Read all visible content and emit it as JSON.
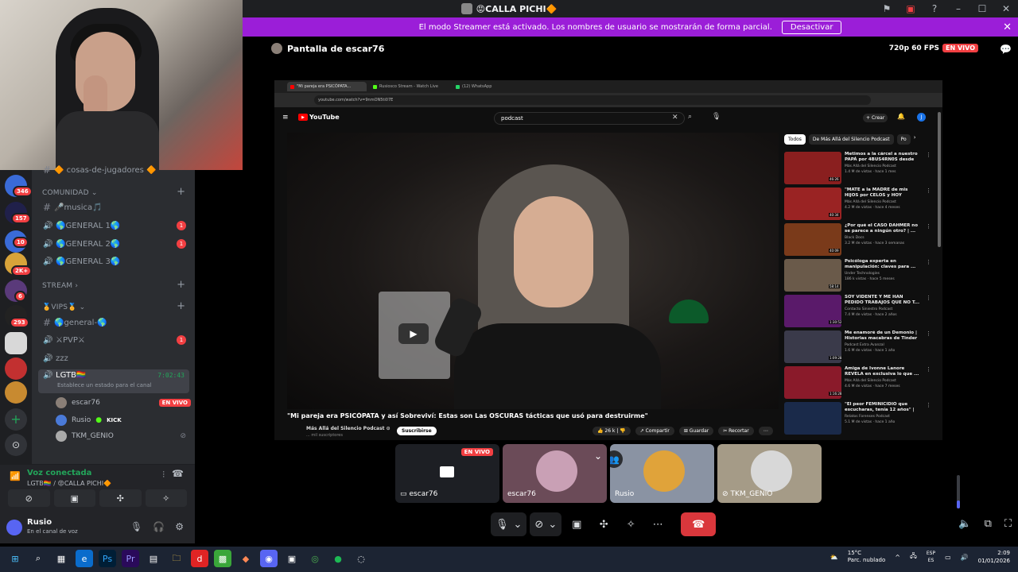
{
  "window": {
    "title": "😡CALLA PICHI🔶"
  },
  "banner": {
    "text": "El modo Streamer está activado. Los nombres de usuario se mostrarán de forma parcial.",
    "button": "Desactivar"
  },
  "rail": {
    "badges": [
      "346",
      "157",
      "10",
      "2K+",
      "6",
      "293"
    ]
  },
  "sidebar": {
    "partial_top": "🔶 cosas-de-jugadores 🔶",
    "categories": {
      "comunidad": "COMUNIDAD",
      "stream": "STREAM",
      "vips": "🏅VIPS🏅"
    },
    "channels": {
      "musica": "🎤musica🎵",
      "general1": "🌎GENERAL 1🌎",
      "general2": "🌎GENERAL 2🌎",
      "general3": "🌎GENERAL 3🌎",
      "general_text": "🌎general-🌎",
      "pvp": "⚔PVP⚔",
      "zzz": "zzz",
      "lgtb": "LGTB🏳‍🌈",
      "lgtb_time": "7:02:43",
      "lgtb_status": "Establece un estado para el canal"
    },
    "mentions": {
      "general1": "1",
      "general2": "1",
      "pvp": "1"
    },
    "voice_users": [
      {
        "name": "escar76",
        "tag": "EN VIVO"
      },
      {
        "name": "Rusio",
        "tag": "KICK"
      },
      {
        "name": "TKM_GENIO",
        "tag": ""
      }
    ]
  },
  "voice_panel": {
    "status": "Voz conectada",
    "channel": "LGTB🏳‍🌈 / 😡CALLA PICHI🔶"
  },
  "user": {
    "name": "Rusio",
    "status": "En el canal de voz"
  },
  "stream": {
    "host": "Pantalla de escar76",
    "quality": "720p 60 FPS",
    "live": "EN VIVO"
  },
  "browser": {
    "tabs": [
      "\"Mi pareja era PSICÓPATA...",
      "Rusiosco Stream - Watch Live",
      "(12) WhatsApp"
    ],
    "url": "youtube.com/watch?v=9nmON5ti07E",
    "yt_logo": "YouTube",
    "search": "podcast",
    "create": "Crear",
    "avatar": "J"
  },
  "video": {
    "title": "\"Mi pareja era PSICÓPATA y así Sobreviví: Estas son Las OSCURAS tácticas que usó para destruirme\"",
    "channel": "Más Allá del Silencio Podcast ⊙",
    "subs": "... mil suscriptores",
    "subscribe": "Suscribirse",
    "likes": "26 k",
    "share": "Compartir",
    "save": "Guardar",
    "clip": "Recortar"
  },
  "chips": [
    "Todos",
    "De Más Allá del Silencio Podcast",
    "Po"
  ],
  "recommendations": [
    {
      "title": "Metimos a la cárcel a nuestro PAPÁ por 4BUS4RN0S desde ...",
      "channel": "Más Allá del Silencio Podcast",
      "views": "1.4 M de vistas · hace 1 mes",
      "duration": "46:26",
      "color": "#8a1f1f"
    },
    {
      "title": "\"MATÉ a la MADRE de mis HIJOS por CELOS y HOY cump...",
      "channel": "Más Allá del Silencio Podcast",
      "views": "4.2 M de vistas · hace 4 meses",
      "duration": "40:34",
      "color": "#9a2323"
    },
    {
      "title": "¿Por qué el CASO DAHMER no se parece a ningún otro? | ...",
      "channel": "Black Docs",
      "views": "3.2 M de vistas · hace 3 semanas",
      "duration": "40:09",
      "color": "#7a3a1a"
    },
    {
      "title": "Psicóloga experta en manipulación: claves para ...",
      "channel": "Under Technologies",
      "views": "186 k vistas · hace 5 meses",
      "duration": "58:14",
      "color": "#6a5a4a"
    },
    {
      "title": "SOY VIDENTE Y ME HAN PEDIDO TRABAJOS QUE NO T...",
      "channel": "Contacto Siniestro Podcast",
      "views": "7.4 M de vistas · hace 2 años",
      "duration": "1:30:52",
      "color": "#5a1a6a"
    },
    {
      "title": "Me enamoré de un Demonio | Historias macabras de Tinder",
      "channel": "Podcast Extra Avanzal",
      "views": "1.6 M de vistas · hace 1 año",
      "duration": "1:09:28",
      "color": "#3a3a4a"
    },
    {
      "title": "Amiga de Ivonne Lanore REVELA en exclusiva lo que ...",
      "channel": "Más Allá del Silencio Podcast",
      "views": "4.6 M de vistas · hace 7 meses",
      "duration": "1:16:28",
      "color": "#8a1a2a"
    },
    {
      "title": "\"El peor FEMINICIDIO que escucharas, tenía 12 años\" | ...",
      "channel": "Relatos Forenses Podcast",
      "views": "5.1 M de vistas · hace 1 año",
      "duration": "",
      "color": "#1a2a4a"
    }
  ],
  "tiles": [
    {
      "name": "escar76",
      "live": "EN VIVO",
      "color": "#1d1f24"
    },
    {
      "name": "escar76",
      "live": "",
      "color": "#6b4b58"
    },
    {
      "name": "Rusio",
      "live": "",
      "color": "#8a93a3"
    },
    {
      "name": "TKM_GENIO",
      "live": "",
      "color": "#a59b87"
    }
  ],
  "taskbar": {
    "weather_temp": "15°C",
    "weather_desc": "Parc. nublado",
    "lang1": "ESP",
    "lang2": "ES",
    "time": "2:09",
    "date": "01/01/2026"
  }
}
